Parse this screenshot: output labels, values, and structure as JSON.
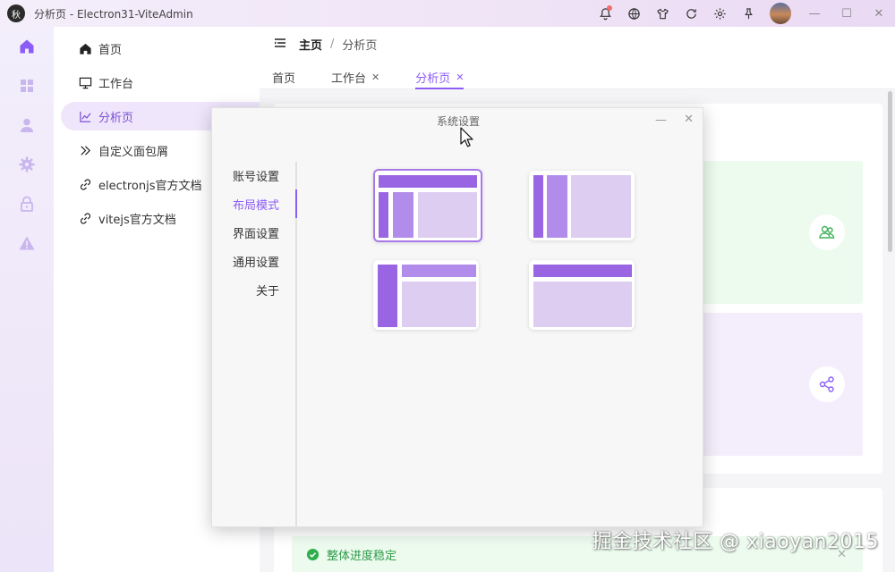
{
  "window": {
    "logo_text": "秋",
    "title": "分析页 - Electron31-ViteAdmin"
  },
  "titlebar_icons": [
    "bell-icon",
    "globe-icon",
    "tshirt-icon",
    "refresh-icon",
    "gear-icon",
    "pin-icon"
  ],
  "window_controls": {
    "minimize": "—",
    "maximize": "☐",
    "close": "✕"
  },
  "rail": [
    "home-icon",
    "grid-icon",
    "user-icon",
    "gear-icon",
    "lock-icon",
    "warning-icon"
  ],
  "submenu": {
    "items": [
      {
        "label": "首页",
        "icon": "home-icon"
      },
      {
        "label": "工作台",
        "icon": "monitor-icon"
      },
      {
        "label": "分析页",
        "icon": "chart-icon"
      },
      {
        "label": "自定义面包屑",
        "icon": "chevrons-icon"
      },
      {
        "label": "electronjs官方文档",
        "icon": "link-icon"
      },
      {
        "label": "vitejs官方文档",
        "icon": "link-icon"
      }
    ]
  },
  "breadcrumb": {
    "home": "主页",
    "separator": "/",
    "current": "分析页"
  },
  "tabs": [
    {
      "label": "首页"
    },
    {
      "label": "工作台",
      "close": "✕"
    },
    {
      "label": "分析页",
      "close": "✕"
    }
  ],
  "alert": {
    "text": "整体进度稳定",
    "close": "✕"
  },
  "dialog": {
    "title": "系统设置",
    "minimize": "—",
    "close": "✕",
    "nav": [
      "账号设置",
      "布局模式",
      "界面设置",
      "通用设置",
      "关于"
    ],
    "active_nav": "布局模式"
  },
  "colors": {
    "accent": "#8b5cf6",
    "layout_dark": "#9a65e2",
    "layout_mid": "#b18ceb",
    "layout_light": "#dccdf1"
  },
  "watermark": "掘金技术社区 @ xiaoyan2015"
}
